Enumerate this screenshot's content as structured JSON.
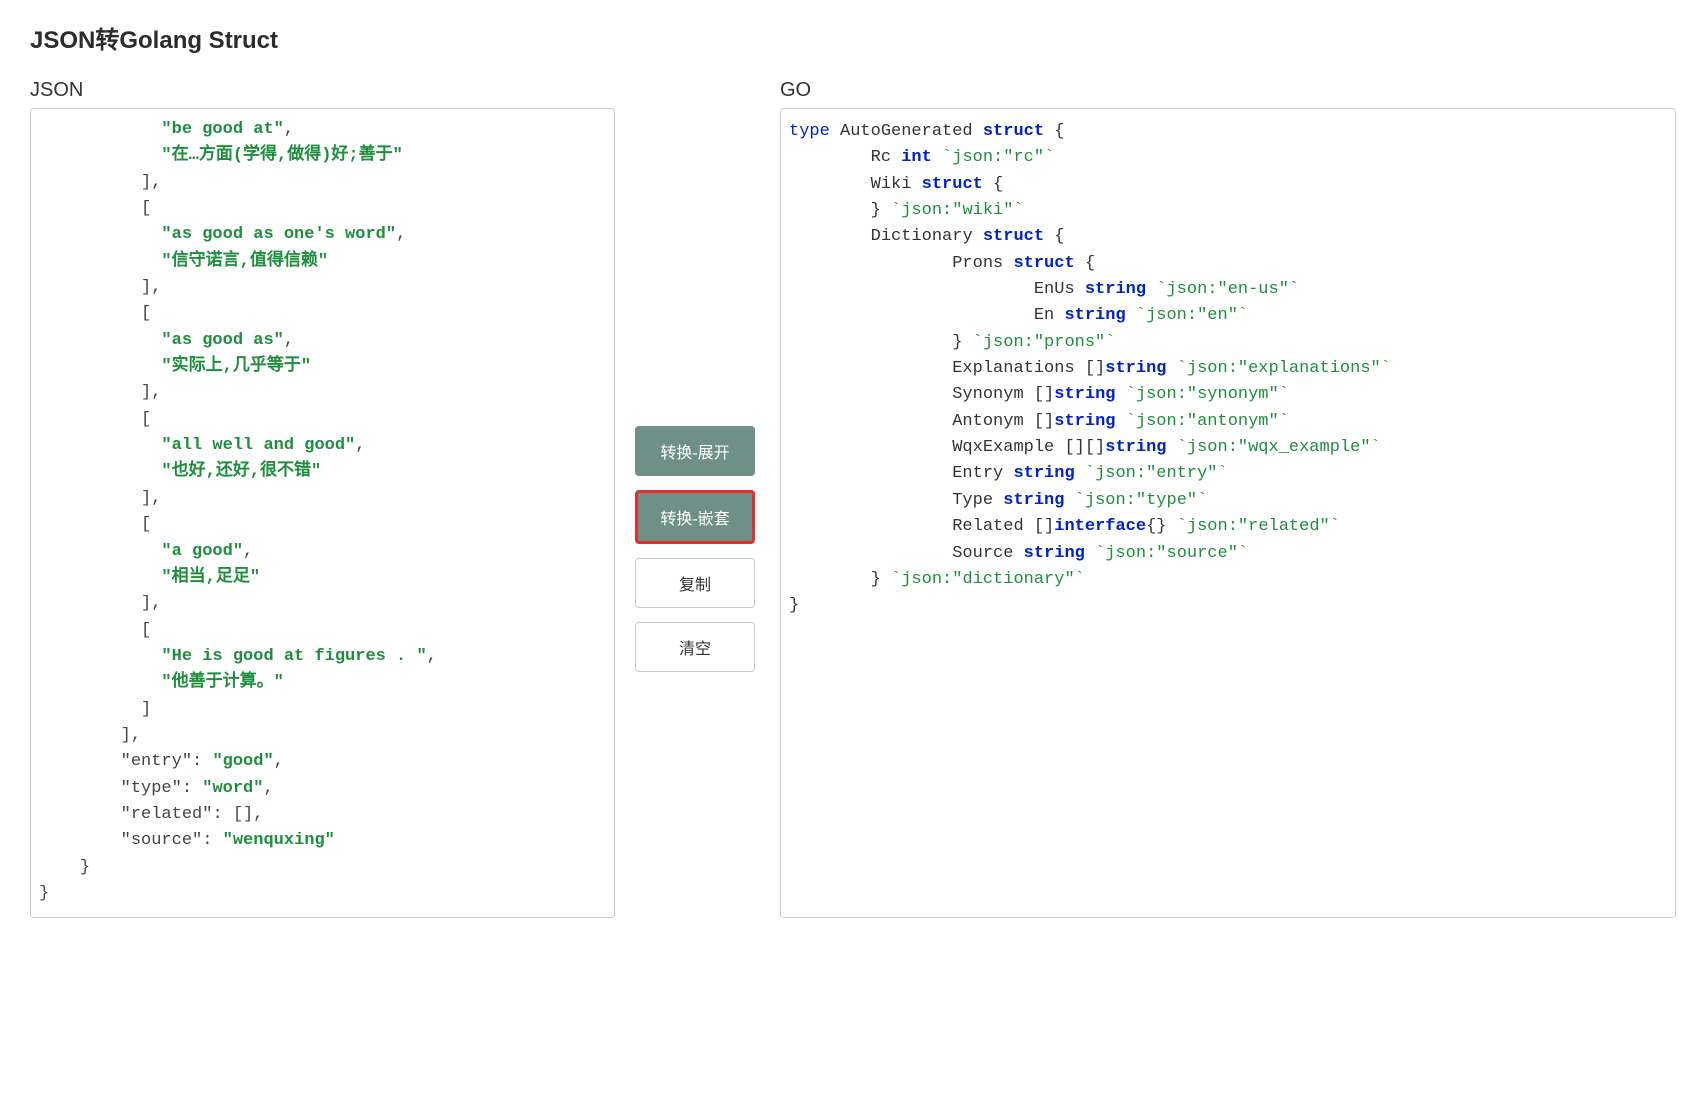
{
  "page_title": "JSON转Golang Struct",
  "labels": {
    "json": "JSON",
    "go": "GO"
  },
  "buttons": {
    "convert_expand": "转换-展开",
    "convert_nest": "转换-嵌套",
    "copy": "复制",
    "clear": "清空"
  },
  "json_lines": [
    {
      "indent": 6,
      "tokens": [
        {
          "t": "\"be good at\"",
          "c": "j-str"
        },
        {
          "t": ",",
          "c": "j-punct"
        }
      ]
    },
    {
      "indent": 6,
      "tokens": [
        {
          "t": "\"在…方面(学得,做得)好;善于\"",
          "c": "j-str"
        }
      ]
    },
    {
      "indent": 5,
      "tokens": [
        {
          "t": "],",
          "c": "j-bracket"
        }
      ]
    },
    {
      "indent": 5,
      "tokens": [
        {
          "t": "[",
          "c": "j-bracket"
        }
      ]
    },
    {
      "indent": 6,
      "tokens": [
        {
          "t": "\"as good as one's word\"",
          "c": "j-str"
        },
        {
          "t": ",",
          "c": "j-punct"
        }
      ]
    },
    {
      "indent": 6,
      "tokens": [
        {
          "t": "\"信守诺言,值得信赖\"",
          "c": "j-str"
        }
      ]
    },
    {
      "indent": 5,
      "tokens": [
        {
          "t": "],",
          "c": "j-bracket"
        }
      ]
    },
    {
      "indent": 5,
      "tokens": [
        {
          "t": "[",
          "c": "j-bracket"
        }
      ]
    },
    {
      "indent": 6,
      "tokens": [
        {
          "t": "\"as good as\"",
          "c": "j-str"
        },
        {
          "t": ",",
          "c": "j-punct"
        }
      ]
    },
    {
      "indent": 6,
      "tokens": [
        {
          "t": "\"实际上,几乎等于\"",
          "c": "j-str"
        }
      ]
    },
    {
      "indent": 5,
      "tokens": [
        {
          "t": "],",
          "c": "j-bracket"
        }
      ]
    },
    {
      "indent": 5,
      "tokens": [
        {
          "t": "[",
          "c": "j-bracket"
        }
      ]
    },
    {
      "indent": 6,
      "tokens": [
        {
          "t": "\"all well and good\"",
          "c": "j-str"
        },
        {
          "t": ",",
          "c": "j-punct"
        }
      ]
    },
    {
      "indent": 6,
      "tokens": [
        {
          "t": "\"也好,还好,很不错\"",
          "c": "j-str"
        }
      ]
    },
    {
      "indent": 5,
      "tokens": [
        {
          "t": "],",
          "c": "j-bracket"
        }
      ]
    },
    {
      "indent": 5,
      "tokens": [
        {
          "t": "[",
          "c": "j-bracket"
        }
      ]
    },
    {
      "indent": 6,
      "tokens": [
        {
          "t": "\"a good\"",
          "c": "j-str"
        },
        {
          "t": ",",
          "c": "j-punct"
        }
      ]
    },
    {
      "indent": 6,
      "tokens": [
        {
          "t": "\"相当,足足\"",
          "c": "j-str"
        }
      ]
    },
    {
      "indent": 5,
      "tokens": [
        {
          "t": "],",
          "c": "j-bracket"
        }
      ]
    },
    {
      "indent": 5,
      "tokens": [
        {
          "t": "[",
          "c": "j-bracket"
        }
      ]
    },
    {
      "indent": 6,
      "tokens": [
        {
          "t": "\"He is good at figures . \"",
          "c": "j-str"
        },
        {
          "t": ",",
          "c": "j-punct"
        }
      ]
    },
    {
      "indent": 6,
      "tokens": [
        {
          "t": "\"他善于计算。\"",
          "c": "j-str"
        }
      ]
    },
    {
      "indent": 5,
      "tokens": [
        {
          "t": "]",
          "c": "j-bracket"
        }
      ]
    },
    {
      "indent": 4,
      "tokens": [
        {
          "t": "],",
          "c": "j-bracket"
        }
      ]
    },
    {
      "indent": 4,
      "tokens": [
        {
          "t": "\"entry\"",
          "c": "j-key"
        },
        {
          "t": ": ",
          "c": "j-punct"
        },
        {
          "t": "\"good\"",
          "c": "j-str"
        },
        {
          "t": ",",
          "c": "j-punct"
        }
      ]
    },
    {
      "indent": 4,
      "tokens": [
        {
          "t": "\"type\"",
          "c": "j-key"
        },
        {
          "t": ": ",
          "c": "j-punct"
        },
        {
          "t": "\"word\"",
          "c": "j-str"
        },
        {
          "t": ",",
          "c": "j-punct"
        }
      ]
    },
    {
      "indent": 4,
      "tokens": [
        {
          "t": "\"related\"",
          "c": "j-key"
        },
        {
          "t": ": ",
          "c": "j-punct"
        },
        {
          "t": "[],",
          "c": "j-bracket"
        }
      ]
    },
    {
      "indent": 4,
      "tokens": [
        {
          "t": "\"source\"",
          "c": "j-key"
        },
        {
          "t": ": ",
          "c": "j-punct"
        },
        {
          "t": "\"wenquxing\"",
          "c": "j-str"
        }
      ]
    },
    {
      "indent": 2,
      "tokens": [
        {
          "t": "}",
          "c": "j-bracket"
        }
      ]
    },
    {
      "indent": 0,
      "tokens": [
        {
          "t": "}",
          "c": "j-bracket"
        }
      ]
    }
  ],
  "go_lines": [
    {
      "indent": 0,
      "tokens": [
        {
          "t": "type ",
          "c": "g-kw"
        },
        {
          "t": "AutoGenerated ",
          "c": "g-ident"
        },
        {
          "t": "struct",
          "c": "g-type"
        },
        {
          "t": " {",
          "c": "g-ident"
        }
      ]
    },
    {
      "indent": 4,
      "tokens": [
        {
          "t": "Rc ",
          "c": "g-ident"
        },
        {
          "t": "int",
          "c": "g-type"
        },
        {
          "t": " ",
          "c": ""
        },
        {
          "t": "`json:\"rc\"`",
          "c": "g-tag"
        }
      ]
    },
    {
      "indent": 4,
      "tokens": [
        {
          "t": "Wiki ",
          "c": "g-ident"
        },
        {
          "t": "struct",
          "c": "g-type"
        },
        {
          "t": " {",
          "c": "g-ident"
        }
      ]
    },
    {
      "indent": 4,
      "tokens": [
        {
          "t": "} ",
          "c": "g-ident"
        },
        {
          "t": "`json:\"wiki\"`",
          "c": "g-tag"
        }
      ]
    },
    {
      "indent": 4,
      "tokens": [
        {
          "t": "Dictionary ",
          "c": "g-ident"
        },
        {
          "t": "struct",
          "c": "g-type"
        },
        {
          "t": " {",
          "c": "g-ident"
        }
      ]
    },
    {
      "indent": 8,
      "tokens": [
        {
          "t": "Prons ",
          "c": "g-ident"
        },
        {
          "t": "struct",
          "c": "g-type"
        },
        {
          "t": " {",
          "c": "g-ident"
        }
      ]
    },
    {
      "indent": 12,
      "tokens": [
        {
          "t": "EnUs ",
          "c": "g-ident"
        },
        {
          "t": "string",
          "c": "g-type"
        },
        {
          "t": " ",
          "c": ""
        },
        {
          "t": "`json:\"en-us\"`",
          "c": "g-tag"
        }
      ]
    },
    {
      "indent": 12,
      "tokens": [
        {
          "t": "En ",
          "c": "g-ident"
        },
        {
          "t": "string",
          "c": "g-type"
        },
        {
          "t": " ",
          "c": ""
        },
        {
          "t": "`json:\"en\"`",
          "c": "g-tag"
        }
      ]
    },
    {
      "indent": 8,
      "tokens": [
        {
          "t": "} ",
          "c": "g-ident"
        },
        {
          "t": "`json:\"prons\"`",
          "c": "g-tag"
        }
      ]
    },
    {
      "indent": 8,
      "tokens": [
        {
          "t": "Explanations []",
          "c": "g-ident"
        },
        {
          "t": "string",
          "c": "g-type"
        },
        {
          "t": " ",
          "c": ""
        },
        {
          "t": "`json:\"explanations\"`",
          "c": "g-tag"
        }
      ]
    },
    {
      "indent": 8,
      "tokens": [
        {
          "t": "Synonym []",
          "c": "g-ident"
        },
        {
          "t": "string",
          "c": "g-type"
        },
        {
          "t": " ",
          "c": ""
        },
        {
          "t": "`json:\"synonym\"`",
          "c": "g-tag"
        }
      ]
    },
    {
      "indent": 8,
      "tokens": [
        {
          "t": "Antonym []",
          "c": "g-ident"
        },
        {
          "t": "string",
          "c": "g-type"
        },
        {
          "t": " ",
          "c": ""
        },
        {
          "t": "`json:\"antonym\"`",
          "c": "g-tag"
        }
      ]
    },
    {
      "indent": 8,
      "tokens": [
        {
          "t": "WqxExample [][]",
          "c": "g-ident"
        },
        {
          "t": "string",
          "c": "g-type"
        },
        {
          "t": " ",
          "c": ""
        },
        {
          "t": "`json:\"wqx_example\"`",
          "c": "g-tag"
        }
      ]
    },
    {
      "indent": 8,
      "tokens": [
        {
          "t": "Entry ",
          "c": "g-ident"
        },
        {
          "t": "string",
          "c": "g-type"
        },
        {
          "t": " ",
          "c": ""
        },
        {
          "t": "`json:\"entry\"`",
          "c": "g-tag"
        }
      ]
    },
    {
      "indent": 8,
      "tokens": [
        {
          "t": "Type ",
          "c": "g-ident"
        },
        {
          "t": "string",
          "c": "g-type"
        },
        {
          "t": " ",
          "c": ""
        },
        {
          "t": "`json:\"type\"`",
          "c": "g-tag"
        }
      ]
    },
    {
      "indent": 8,
      "tokens": [
        {
          "t": "Related []",
          "c": "g-ident"
        },
        {
          "t": "interface",
          "c": "g-type"
        },
        {
          "t": "{} ",
          "c": "g-ident"
        },
        {
          "t": "`json:\"related\"`",
          "c": "g-tag"
        }
      ]
    },
    {
      "indent": 8,
      "tokens": [
        {
          "t": "Source ",
          "c": "g-ident"
        },
        {
          "t": "string",
          "c": "g-type"
        },
        {
          "t": " ",
          "c": ""
        },
        {
          "t": "`json:\"source\"`",
          "c": "g-tag"
        }
      ]
    },
    {
      "indent": 4,
      "tokens": [
        {
          "t": "} ",
          "c": "g-ident"
        },
        {
          "t": "`json:\"dictionary\"`",
          "c": "g-tag"
        }
      ]
    },
    {
      "indent": 0,
      "tokens": [
        {
          "t": "}",
          "c": "g-ident"
        }
      ]
    }
  ]
}
